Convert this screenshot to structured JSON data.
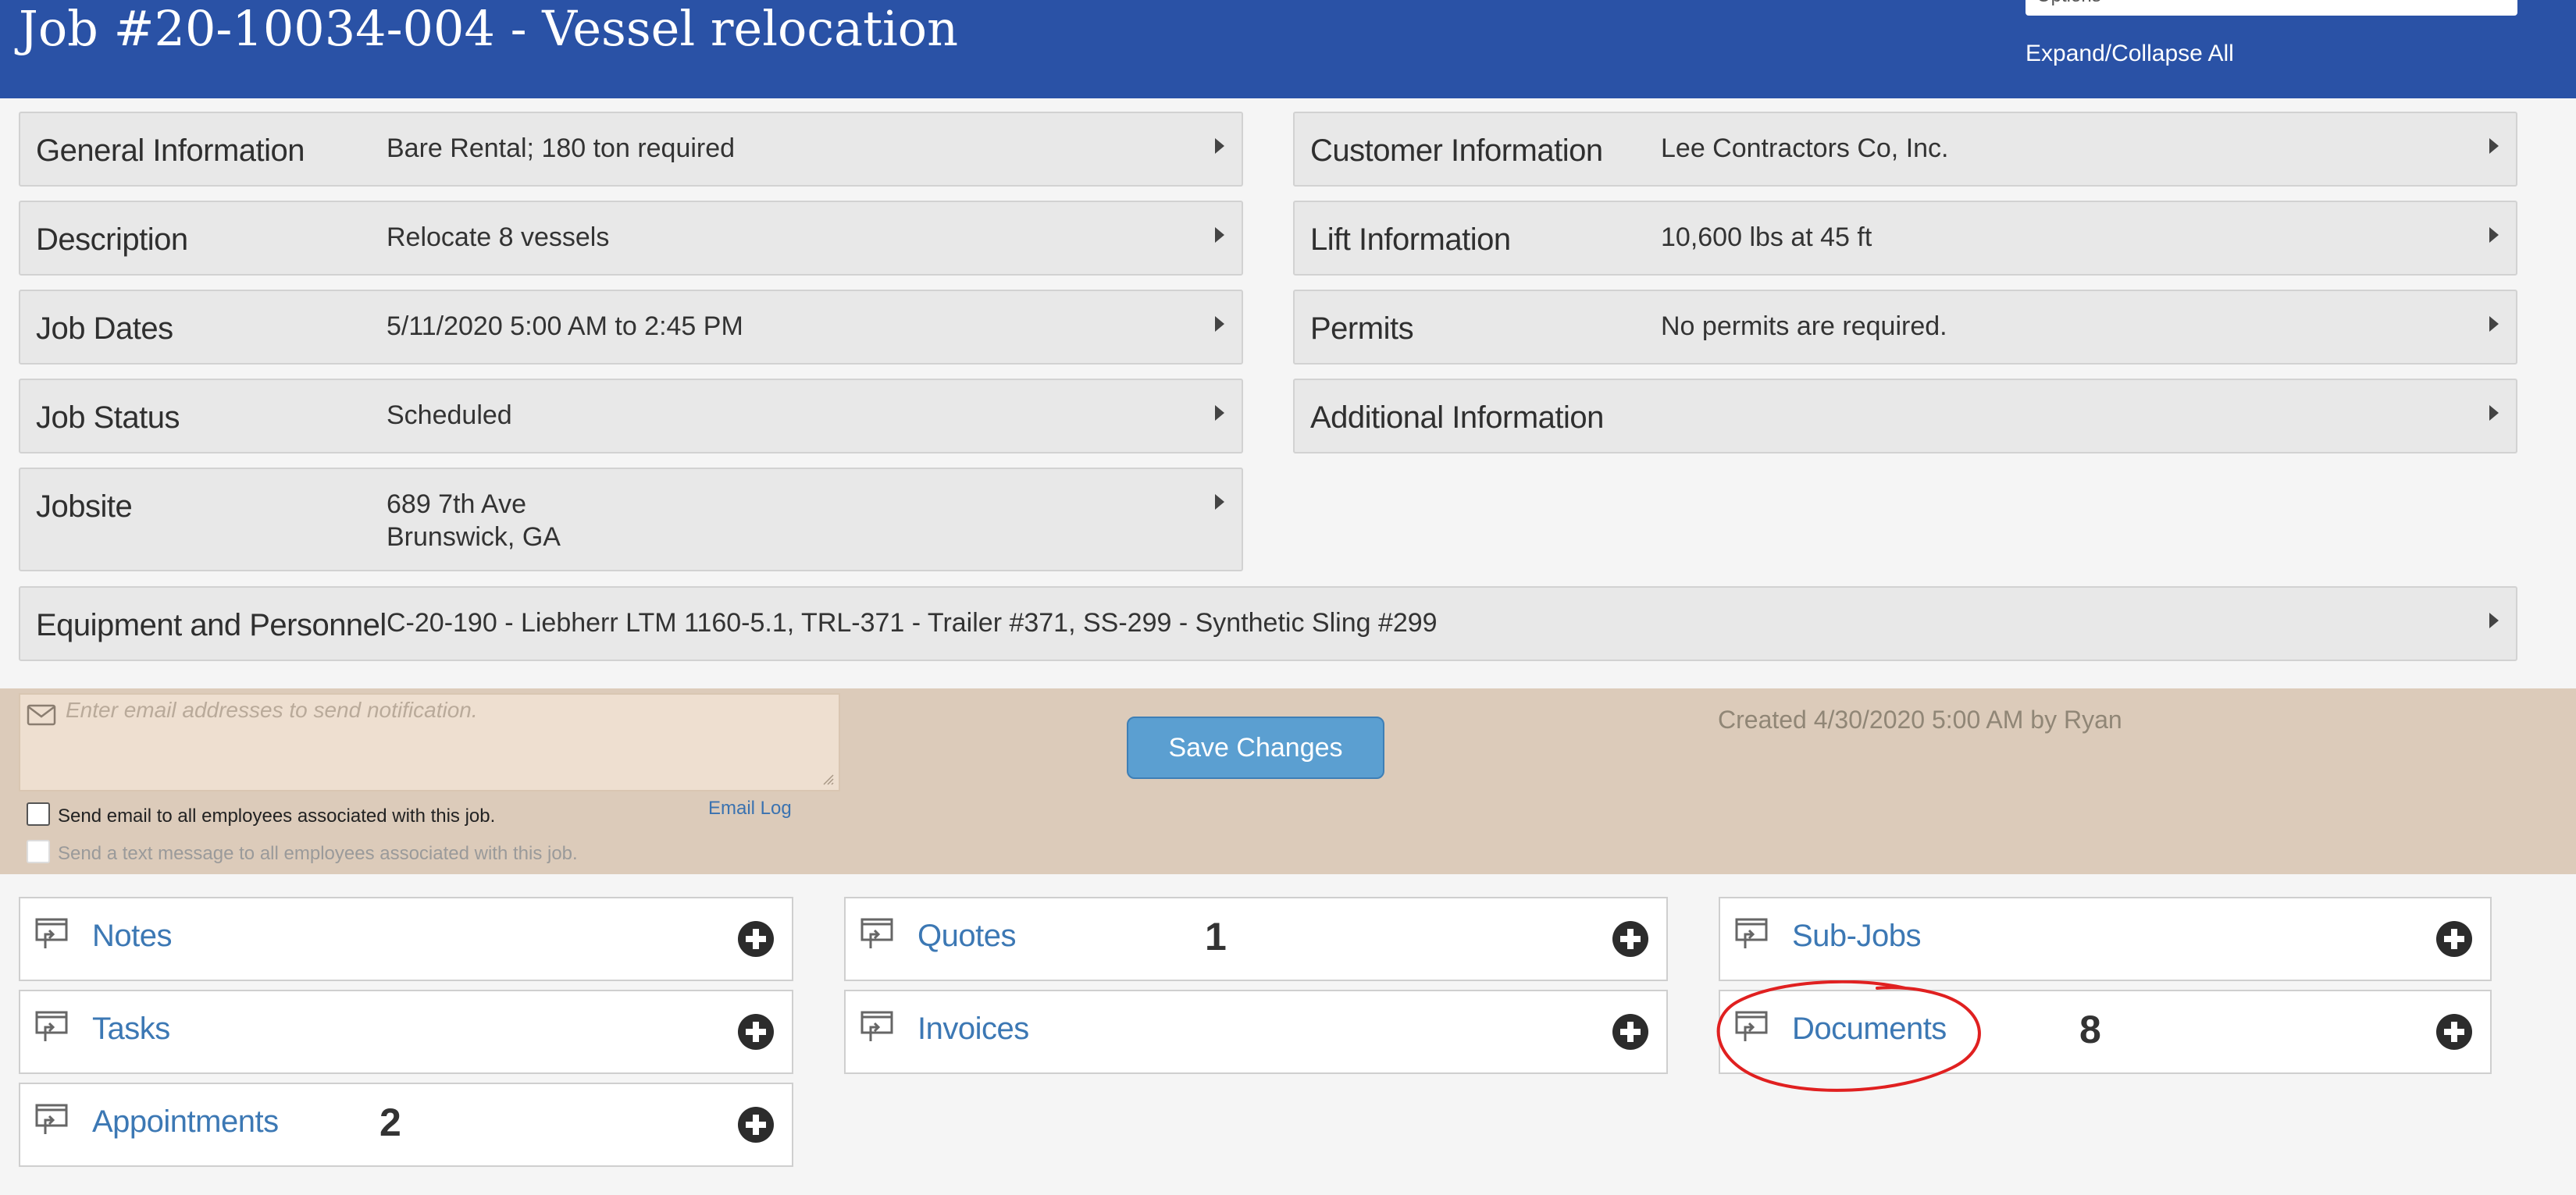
{
  "header": {
    "title": "Job #20-10034-004 - Vessel relocation",
    "options_label": "Options",
    "expand_collapse": "Expand/Collapse All"
  },
  "panels_left": [
    {
      "label": "General Information",
      "value": "Bare Rental; 180 ton required"
    },
    {
      "label": "Description",
      "value": "Relocate 8 vessels"
    },
    {
      "label": "Job Dates",
      "value": "5/11/2020 5:00 AM to 2:45 PM"
    },
    {
      "label": "Job Status",
      "value": "Scheduled"
    },
    {
      "label": "Jobsite",
      "value_line1": "689 7th Ave",
      "value_line2": "Brunswick, GA"
    }
  ],
  "panels_right": [
    {
      "label": "Customer Information",
      "value": "Lee Contractors Co, Inc."
    },
    {
      "label": "Lift Information",
      "value": "10,600 lbs at 45 ft"
    },
    {
      "label": "Permits",
      "value": "No permits are required."
    },
    {
      "label": "Additional Information",
      "value": ""
    }
  ],
  "equipment": {
    "label": "Equipment and Personnel",
    "value": "C-20-190 - Liebherr LTM 1160-5.1, TRL-371 - Trailer #371, SS-299 - Synthetic Sling #299"
  },
  "notify": {
    "email_placeholder": "Enter email addresses to send notification.",
    "send_email_label": "Send email to all employees associated with this job.",
    "send_text_label": "Send a text message to all employees associated with this job.",
    "email_log": "Email Log",
    "save_label": "Save Changes",
    "created": "Created 4/30/2020 5:00 AM by Ryan"
  },
  "subsections": {
    "notes": {
      "label": "Notes",
      "count": ""
    },
    "quotes": {
      "label": "Quotes",
      "count": "1"
    },
    "subjobs": {
      "label": "Sub-Jobs",
      "count": ""
    },
    "tasks": {
      "label": "Tasks",
      "count": ""
    },
    "invoices": {
      "label": "Invoices",
      "count": ""
    },
    "documents": {
      "label": "Documents",
      "count": "8"
    },
    "appointments": {
      "label": "Appointments",
      "count": "2"
    }
  },
  "colors": {
    "header_bg": "#2a52a6",
    "band_bg": "#dccbba",
    "link": "#3c78b4",
    "button": "#5b9fd1",
    "annotation": "#e02020"
  },
  "icons": [
    "envelope-icon",
    "list-expand-icon",
    "plus-circle-icon",
    "caret-right-icon"
  ]
}
